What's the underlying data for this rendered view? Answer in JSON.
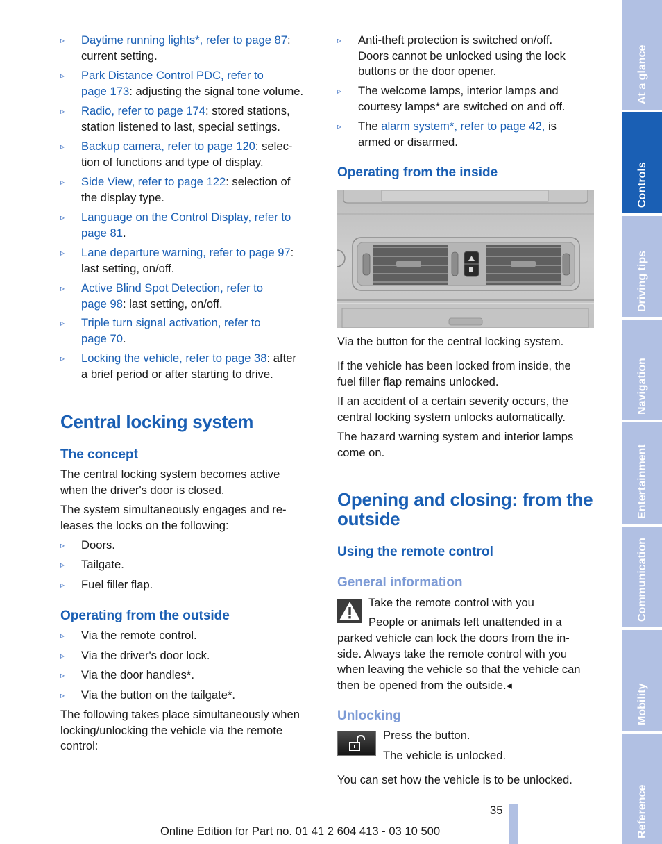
{
  "left_column": {
    "memory_list": [
      {
        "link": "Daytime running lights*, refer to page 87",
        "rest": ":",
        "line2": "current setting."
      },
      {
        "link": "Park Distance Control PDC, refer to",
        "link2": "page 173",
        "rest2": ": adjusting the signal tone volume."
      },
      {
        "link": "Radio, refer to page 174",
        "rest": ": stored stations,",
        "line2": "station listened to last, special settings."
      },
      {
        "link": "Backup camera, refer to page 120",
        "rest": ": selec-",
        "line2": "tion of functions and type of display."
      },
      {
        "link": "Side View, refer to page 122",
        "rest": ": selection of",
        "line2": "the display type."
      },
      {
        "link": "Language on the Control Display, refer to",
        "link2": "page 81",
        "rest2": "."
      },
      {
        "link": "Lane departure warning, refer to page 97",
        "rest": ":",
        "line2": "last setting, on/off."
      },
      {
        "link": "Active Blind Spot Detection, refer to",
        "link2": "page 98",
        "rest2": ": last setting, on/off."
      },
      {
        "link": "Triple turn signal activation, refer to",
        "link2": "page 70",
        "rest2": "."
      },
      {
        "link": "Locking the vehicle, refer to page 38",
        "rest": ": after",
        "line2": "a brief period or after starting to drive."
      }
    ],
    "section_title": "Central locking system",
    "concept_heading": "The concept",
    "concept_p1": [
      "The central locking system becomes active",
      "when the driver's door is closed."
    ],
    "concept_p2": [
      "The system simultaneously engages and re-",
      "leases the locks on the following:"
    ],
    "locks_list": [
      "Doors.",
      "Tailgate.",
      "Fuel filler flap."
    ],
    "outside_heading": "Operating from the outside",
    "outside_list": [
      "Via the remote control.",
      "Via the driver's door lock.",
      "Via the door handles*.",
      "Via the button on the tailgate*."
    ],
    "following_p": [
      "The following takes place simultaneously when",
      "locking/unlocking the vehicle via the remote",
      "control:"
    ]
  },
  "right_column": {
    "remote_list": [
      {
        "lines": [
          "Anti-theft protection is switched on/off.",
          "Doors cannot be unlocked using the lock",
          "buttons or the door opener."
        ]
      },
      {
        "lines": [
          "The welcome lamps, interior lamps and",
          "courtesy lamps* are switched on and off."
        ]
      },
      {
        "pre": "The ",
        "link": "alarm system*, refer to page 42,",
        "post": " is",
        "line2": "armed or disarmed."
      }
    ],
    "inside_heading": "Operating from the inside",
    "image_caption": "Via the button for the central locking system.",
    "inside_p1": [
      "If the vehicle has been locked from inside, the",
      "fuel filler flap remains unlocked."
    ],
    "inside_p2": [
      "If an accident of a certain severity occurs, the",
      "central locking system unlocks automatically."
    ],
    "inside_p3": [
      "The hazard warning system and interior lamps",
      "come on."
    ],
    "opening_title": [
      "Opening and closing: from the",
      "outside"
    ],
    "remote_heading": "Using the remote control",
    "general_heading": "General information",
    "warning_title": "Take the remote control with you",
    "warning_lines": [
      "People or animals left unattended in a",
      "parked vehicle can lock the doors from the in-",
      "side. Always take the remote control with you",
      "when leaving the vehicle so that the vehicle can",
      "then be opened from the outside.◂"
    ],
    "unlocking_heading": "Unlocking",
    "press_button": "Press the button.",
    "vehicle_unlocked": "The vehicle is unlocked.",
    "set_unlock": "You can set how the vehicle is to be unlocked."
  },
  "footer": {
    "page_number": "35",
    "edition": "Online Edition for Part no. 01 41 2 604 413 - 03 10 500"
  },
  "side_tabs": [
    {
      "label": "At a glance",
      "active": false
    },
    {
      "label": "Controls",
      "active": true
    },
    {
      "label": "Driving tips",
      "active": false
    },
    {
      "label": "Navigation",
      "active": false
    },
    {
      "label": "Entertainment",
      "active": false
    },
    {
      "label": "Communication",
      "active": false
    },
    {
      "label": "Mobility",
      "active": false
    },
    {
      "label": "Reference",
      "active": false
    }
  ],
  "icons": {
    "bullet": "▹",
    "warning": "warning-triangle-icon",
    "unlock": "unlock-icon"
  },
  "colors": {
    "heading_blue": "#1a5fb4",
    "subheading_light_blue": "#7d9bd6",
    "tab_inactive": "#b1c0e3",
    "tab_active": "#1a5fb4"
  }
}
